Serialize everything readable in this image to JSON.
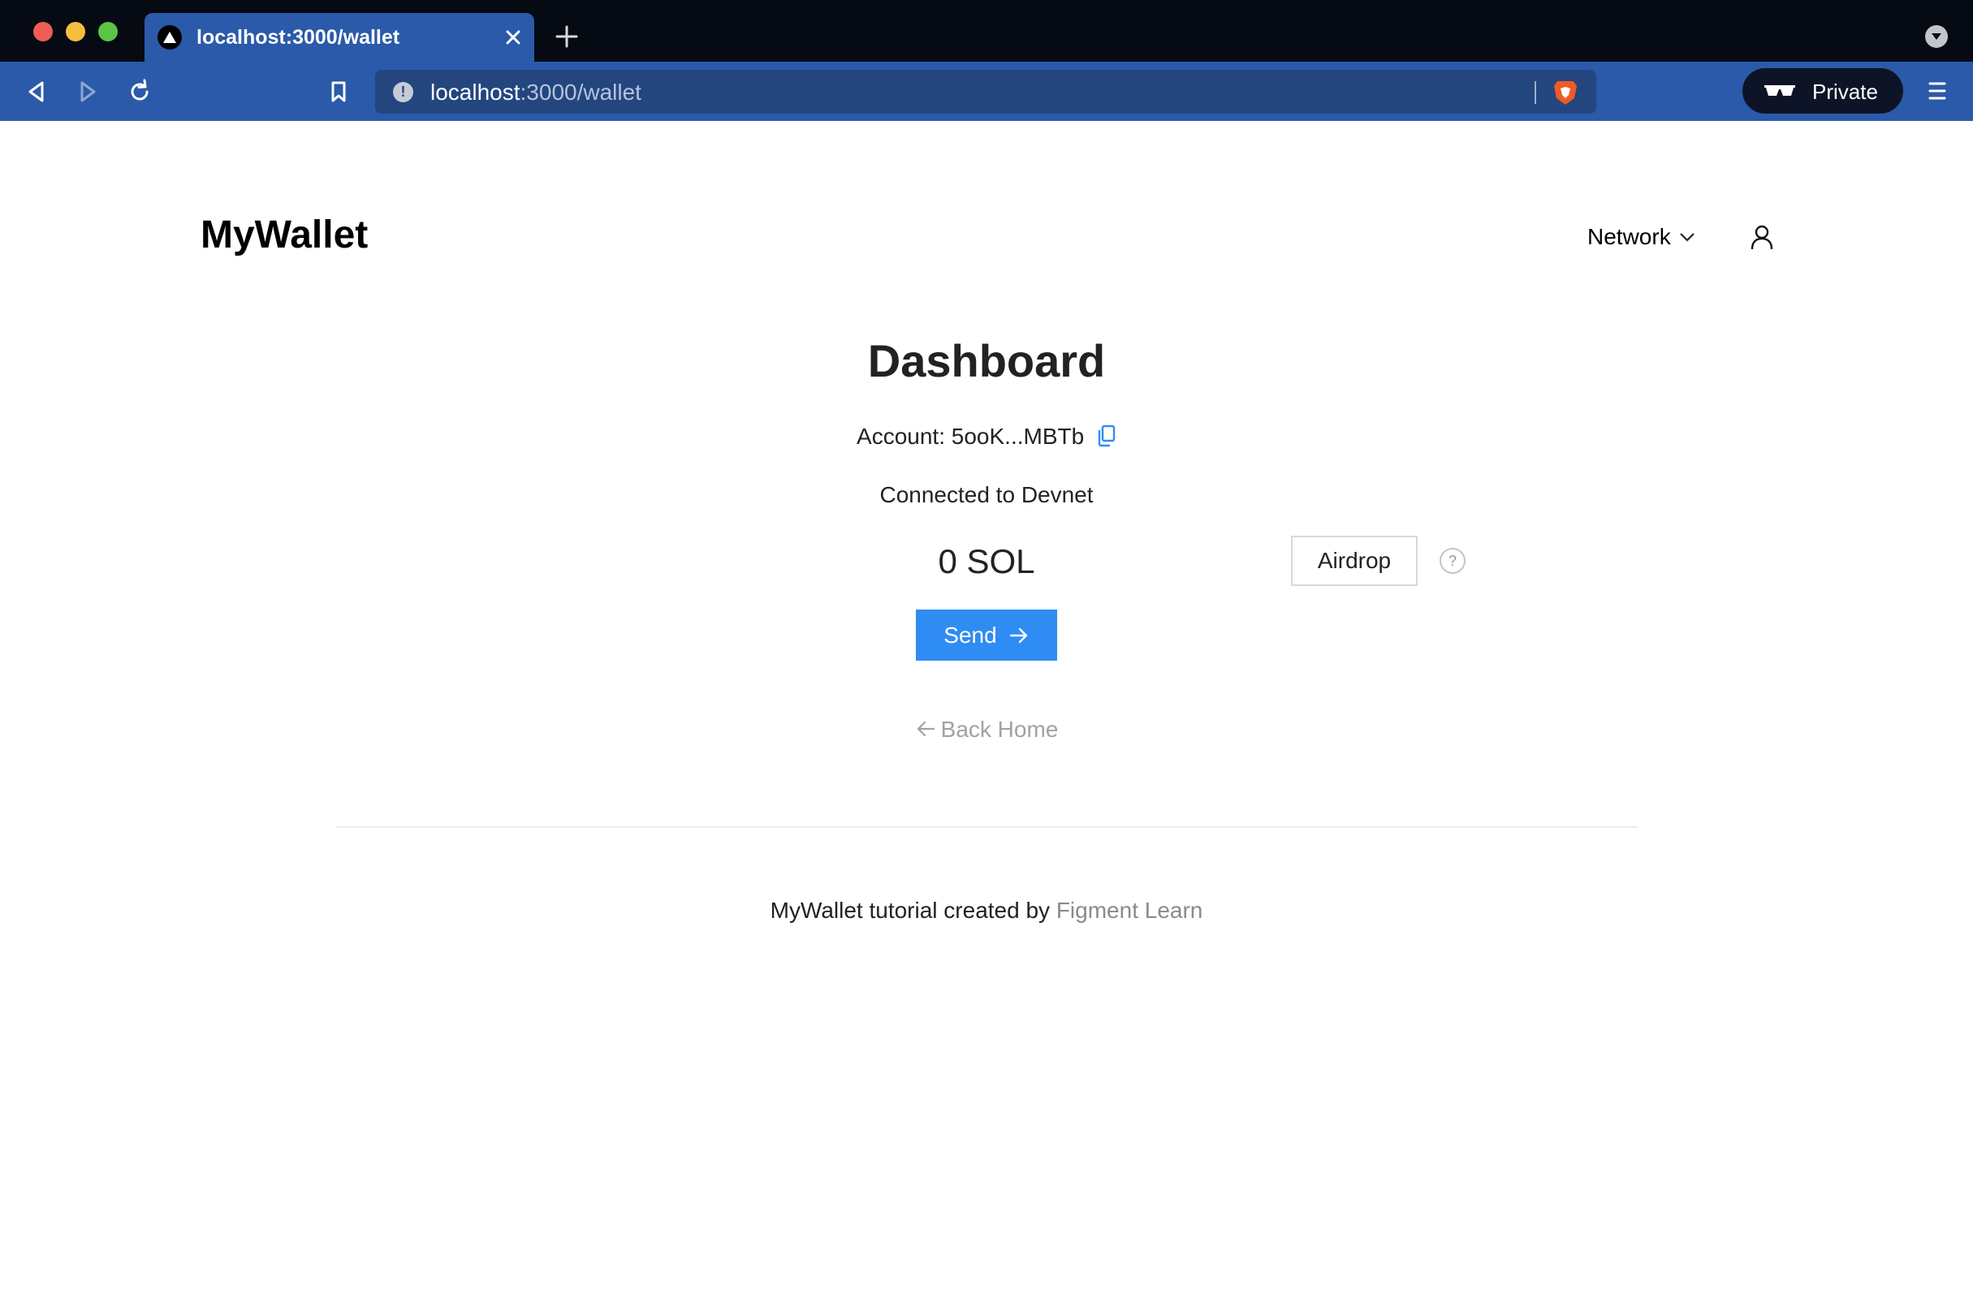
{
  "browser": {
    "tab_title": "localhost:3000/wallet",
    "url_host": "localhost",
    "url_path": ":3000/wallet",
    "private_label": "Private"
  },
  "app": {
    "brand": "MyWallet",
    "network_label": "Network"
  },
  "dashboard": {
    "title": "Dashboard",
    "account_label": "Account:",
    "account_value": "5ooK...MBTb",
    "connected_text": "Connected to Devnet",
    "balance": "0 SOL",
    "airdrop_label": "Airdrop",
    "help_symbol": "?",
    "send_label": "Send",
    "back_home_label": "Back Home"
  },
  "footer": {
    "text": "MyWallet tutorial created by",
    "link_text": "Figment Learn"
  },
  "colors": {
    "chrome_blue": "#2a5aa9",
    "titlebar": "#060a12",
    "primary_button": "#2f8cf3",
    "copy_icon": "#2f8cf3"
  }
}
